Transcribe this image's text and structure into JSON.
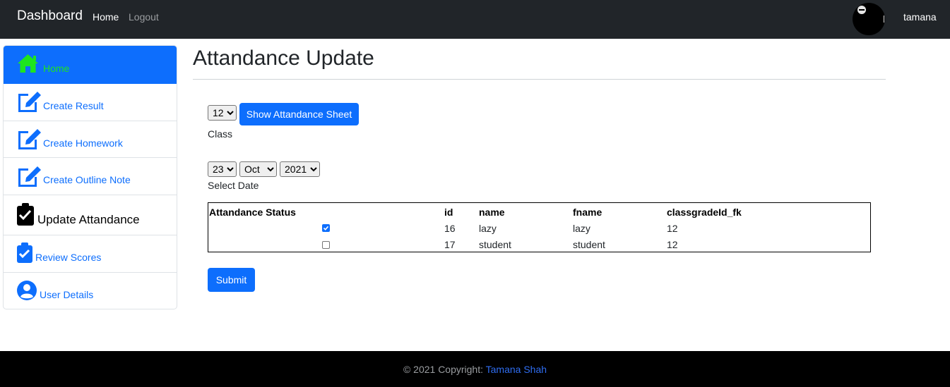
{
  "navbar": {
    "brand": "Dashboard",
    "links": [
      {
        "label": "Home"
      },
      {
        "label": "Logout"
      }
    ],
    "username": "tamana"
  },
  "sidebar": {
    "items": [
      {
        "label": "Home",
        "icon": "house-icon",
        "active": true
      },
      {
        "label": "Create Result",
        "icon": "edit-icon"
      },
      {
        "label": "Create Homework",
        "icon": "edit-icon"
      },
      {
        "label": "Create Outline Note",
        "icon": "edit-icon"
      },
      {
        "label": "Update Attandance",
        "icon": "clipboard-check-icon"
      },
      {
        "label": "Review Scores",
        "icon": "clipboard-check-icon"
      },
      {
        "label": "User Details",
        "icon": "user-circle-icon"
      }
    ]
  },
  "main": {
    "title": "Attandance Update",
    "class_select": {
      "value": "12",
      "label": "Class"
    },
    "show_button": "Show Attandance Sheet",
    "date": {
      "day": "23",
      "month": "Oct",
      "year": "2021",
      "label": "Select Date"
    },
    "table": {
      "headers": [
        "Attandance Status",
        "id",
        "name",
        "fname",
        "classgradeId_fk"
      ],
      "rows": [
        {
          "checked": true,
          "id": "16",
          "name": "lazy",
          "fname": "lazy",
          "classgrade": "12"
        },
        {
          "checked": false,
          "id": "17",
          "name": "student",
          "fname": "student",
          "classgrade": "12"
        }
      ]
    },
    "submit": "Submit"
  },
  "footer": {
    "prefix": "© 2021 Copyright:",
    "author": "Tamana Shah"
  },
  "colors": {
    "navbar": "#212529",
    "primary": "#0d6efd",
    "active_label": "#1ee51e",
    "footer": "#000000"
  }
}
